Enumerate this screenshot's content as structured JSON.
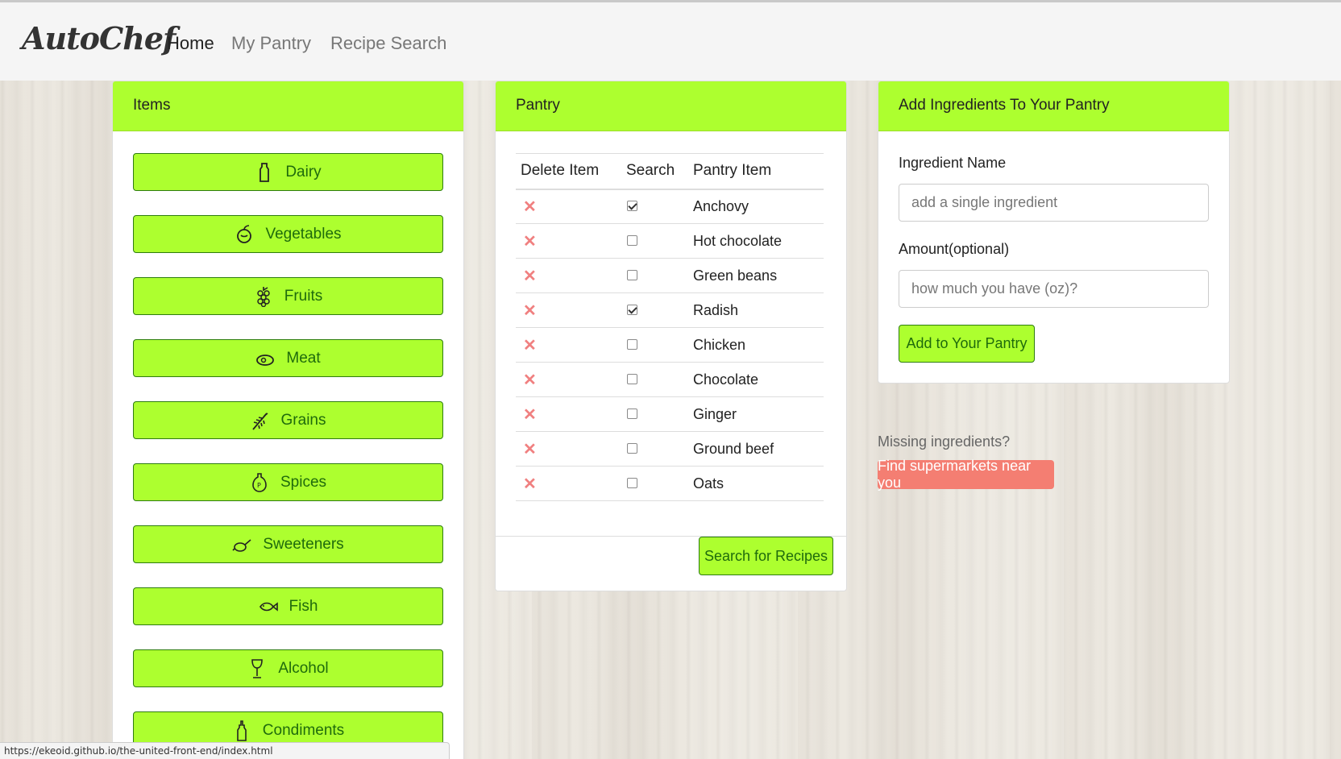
{
  "nav": {
    "brand": "AutoChef",
    "links": [
      {
        "label": "Home",
        "active": true
      },
      {
        "label": "My Pantry",
        "active": false
      },
      {
        "label": "Recipe Search",
        "active": false
      }
    ]
  },
  "items_panel": {
    "title": "Items",
    "categories": [
      {
        "label": "Dairy",
        "icon": "bottle-icon"
      },
      {
        "label": "Vegetables",
        "icon": "vegetable-icon"
      },
      {
        "label": "Fruits",
        "icon": "grapes-icon"
      },
      {
        "label": "Meat",
        "icon": "steak-icon"
      },
      {
        "label": "Grains",
        "icon": "wheat-icon"
      },
      {
        "label": "Spices",
        "icon": "pepper-shaker-icon"
      },
      {
        "label": "Sweeteners",
        "icon": "honey-dipper-icon"
      },
      {
        "label": "Fish",
        "icon": "fish-icon"
      },
      {
        "label": "Alcohol",
        "icon": "wine-glass-icon"
      },
      {
        "label": "Condiments",
        "icon": "condiment-bottle-icon"
      }
    ]
  },
  "pantry_panel": {
    "title": "Pantry",
    "columns": [
      "Delete Item",
      "Search",
      "Pantry Item"
    ],
    "delete_symbol": "✕",
    "rows": [
      {
        "item": "Anchovy",
        "checked": true
      },
      {
        "item": "Hot chocolate",
        "checked": false
      },
      {
        "item": "Green beans",
        "checked": false
      },
      {
        "item": "Radish",
        "checked": true
      },
      {
        "item": "Chicken",
        "checked": false
      },
      {
        "item": "Chocolate",
        "checked": false
      },
      {
        "item": "Ginger",
        "checked": false
      },
      {
        "item": "Ground beef",
        "checked": false
      },
      {
        "item": "Oats",
        "checked": false
      }
    ],
    "search_button": "Search for Recipes"
  },
  "add_panel": {
    "title": "Add Ingredients To Your Pantry",
    "name_label": "Ingredient Name",
    "name_placeholder": "add a single ingredient",
    "amount_label": "Amount(optional)",
    "amount_placeholder": "how much you have (oz)?",
    "add_button": "Add to Your Pantry"
  },
  "missing": {
    "text": "Missing ingredients?",
    "button": "Find supermarkets near you"
  },
  "status_url": "https://ekeoid.github.io/the-united-front-end/index.html",
  "colors": {
    "accent_green": "#adff2f",
    "button_text": "#1f6b0c",
    "delete_red": "#f08080",
    "find_button": "#f47e72"
  }
}
